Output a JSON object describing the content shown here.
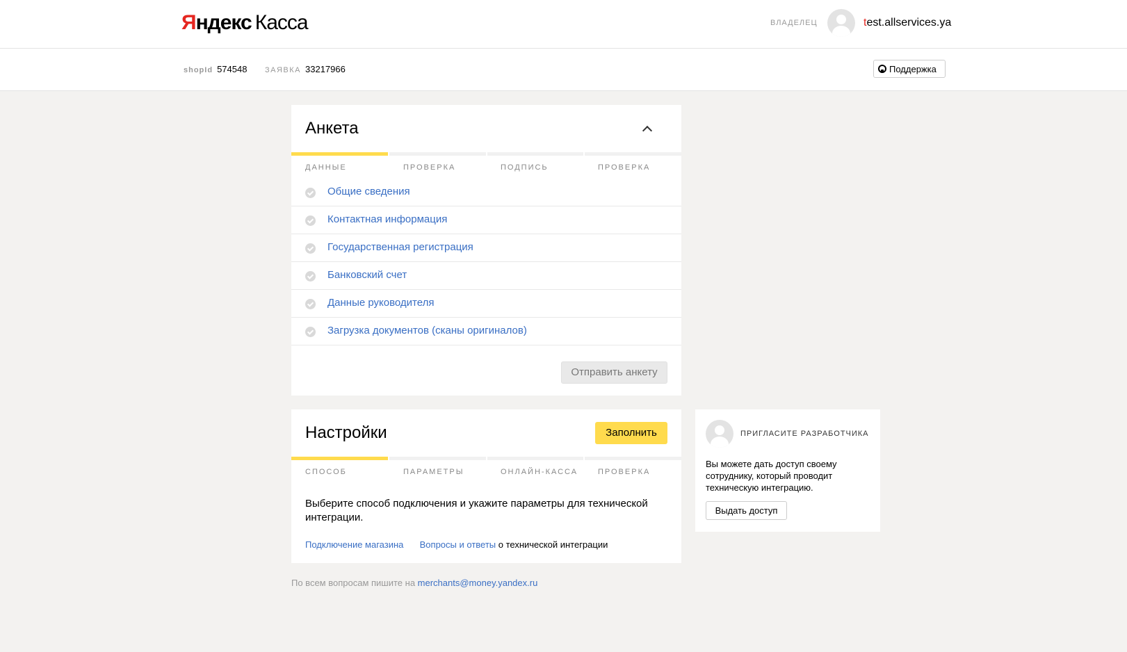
{
  "header": {
    "logo_first": "Яндекс",
    "logo_second": "Касса",
    "owner_label": "ВЛАДЕЛЕЦ",
    "user_first_letter": "t",
    "user_rest": "est.allservices.ya"
  },
  "subheader": {
    "shop_id_label": "shopId",
    "shop_id_value": "574548",
    "request_label": "ЗАЯВКА",
    "request_value": "33217966",
    "support_label": "Поддержка"
  },
  "questionnaire": {
    "title": "Анкета",
    "progress_active_step": 1,
    "steps": [
      "ДАННЫЕ",
      "ПРОВЕРКА",
      "ПОДПИСЬ",
      "ПРОВЕРКА"
    ],
    "items": [
      "Общие сведения",
      "Контактная информация",
      "Государственная регистрация",
      "Банковский счет",
      "Данные руководителя",
      "Загрузка документов (сканы оригиналов)"
    ],
    "submit_label": "Отправить анкету"
  },
  "settings": {
    "title": "Настройки",
    "fill_label": "Заполнить",
    "progress_active_step": 1,
    "steps": [
      "СПОСОБ",
      "ПАРАМЕТРЫ",
      "ОНЛАЙН-КАССА",
      "ПРОВЕРКА"
    ],
    "description": "Выберите способ подключения и укажите параметры для технической интеграции.",
    "link_connection": "Подключение магазина",
    "link_faq": "Вопросы и ответы",
    "link_suffix": " о технической интеграции"
  },
  "invite": {
    "title": "ПРИГЛАСИТЕ РАЗРАБОТЧИКА",
    "text": "Вы можете дать доступ своему сотруднику, который проводит техническую интеграцию.",
    "button_label": "Выдать доступ"
  },
  "footer": {
    "text": "По всем вопросам пишите на ",
    "email": "merchants@money.yandex.ru"
  },
  "colors": {
    "accent_yellow": "#ffdb4d",
    "link_blue": "#3a6fc4",
    "brand_red": "#e52620",
    "page_bg": "#f3f2f0"
  }
}
